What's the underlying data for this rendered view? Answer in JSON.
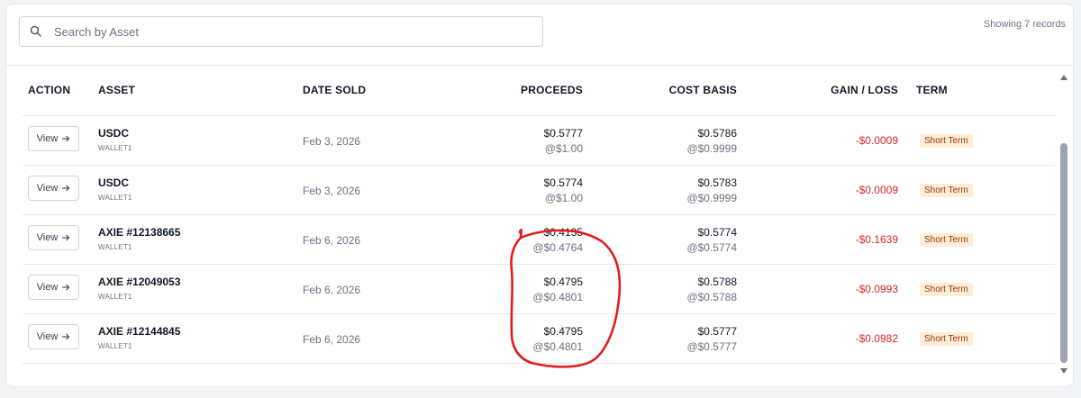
{
  "search": {
    "placeholder": "Search by Asset"
  },
  "records_label": "Showing 7 records",
  "columns": {
    "action": "ACTION",
    "asset": "ASSET",
    "date_sold": "DATE SOLD",
    "proceeds": "PROCEEDS",
    "cost_basis": "COST BASIS",
    "gain_loss": "GAIN / LOSS",
    "term": "TERM"
  },
  "view_label": "View",
  "rows": [
    {
      "asset": "",
      "wallet": "WALLET1",
      "date": "Feb 3, 2026",
      "proceeds": "",
      "proceeds_price": "@$1.00",
      "cost_basis": "",
      "cost_price": "@$0.9999",
      "gain": "-$0.0009",
      "term": "Short Term"
    },
    {
      "asset": "USDC",
      "wallet": "WALLET1",
      "date": "Feb 3, 2026",
      "proceeds": "$0.5777",
      "proceeds_price": "@$1.00",
      "cost_basis": "$0.5786",
      "cost_price": "@$0.9999",
      "gain": "-$0.0009",
      "term": "Short Term"
    },
    {
      "asset": "USDC",
      "wallet": "WALLET1",
      "date": "Feb 3, 2026",
      "proceeds": "$0.5774",
      "proceeds_price": "@$1.00",
      "cost_basis": "$0.5783",
      "cost_price": "@$0.9999",
      "gain": "-$0.0009",
      "term": "Short Term"
    },
    {
      "asset": "AXIE #12138665",
      "wallet": "WALLET1",
      "date": "Feb 6, 2026",
      "proceeds": "$0.4135",
      "proceeds_price": "@$0.4764",
      "cost_basis": "$0.5774",
      "cost_price": "@$0.5774",
      "gain": "-$0.1639",
      "term": "Short Term"
    },
    {
      "asset": "AXIE #12049053",
      "wallet": "WALLET1",
      "date": "Feb 6, 2026",
      "proceeds": "$0.4795",
      "proceeds_price": "@$0.4801",
      "cost_basis": "$0.5788",
      "cost_price": "@$0.5788",
      "gain": "-$0.0993",
      "term": "Short Term"
    },
    {
      "asset": "AXIE #12144845",
      "wallet": "WALLET1",
      "date": "Feb 6, 2026",
      "proceeds": "$0.4795",
      "proceeds_price": "@$0.4801",
      "cost_basis": "$0.5777",
      "cost_price": "@$0.5777",
      "gain": "-$0.0982",
      "term": "Short Term"
    }
  ],
  "colors": {
    "loss": "#dc2626",
    "term_bg": "#ffedd5",
    "term_fg": "#9a3412",
    "annotation": "#e11d1d"
  },
  "icons": {
    "search": "search-icon",
    "view_arrow": "arrow-right-icon"
  }
}
